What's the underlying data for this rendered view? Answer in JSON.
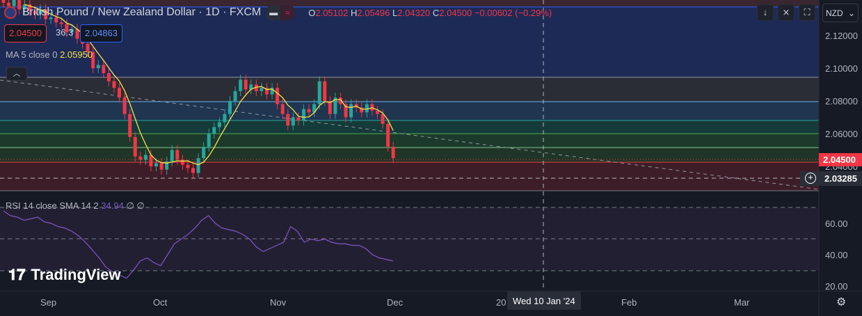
{
  "header": {
    "title": "British Pound / New Zealand Dollar · 1D · FXCM",
    "open_label": "O",
    "open": "2.05102",
    "high_label": "H",
    "high": "2.05496",
    "low_label": "L",
    "low": "2.04320",
    "close_label": "C",
    "close": "2.04500",
    "change": "−0.00602 (−0.29%)"
  },
  "price_boxes": {
    "sell": "2.04500",
    "spread": "36.3",
    "buy": "2.04863"
  },
  "ma": {
    "label": "MA 5 close 0",
    "value": "2.05950"
  },
  "rsi": {
    "label": "RSI 14 close SMA 14 2",
    "value": "34.94",
    "extra": "∅ ∅"
  },
  "toolbar": {
    "currency": "NZD"
  },
  "price_axis": {
    "ticks": [
      "2.12000",
      "2.10000",
      "2.08000",
      "2.06000",
      "2.04000"
    ],
    "last_price": "2.04500",
    "crosshair_price": "2.03285"
  },
  "rsi_axis": {
    "ticks": [
      "60.00",
      "40.00",
      "20.00"
    ]
  },
  "time_axis": {
    "ticks": [
      "Sep",
      "Oct",
      "Nov",
      "Dec",
      "20",
      "Feb",
      "Mar"
    ],
    "crosshair_date": "Wed 10 Jan '24"
  },
  "logo": "TradingView",
  "colors": {
    "up": "#26a69a",
    "down": "#f23645",
    "ma": "#f5e44a",
    "rsi": "#7e57c2"
  },
  "chart_data": {
    "type": "candlestick",
    "closes": [
      2.14,
      2.138,
      2.142,
      2.136,
      2.139,
      2.135,
      2.133,
      2.136,
      2.13,
      2.131,
      2.128,
      2.127,
      2.122,
      2.124,
      2.118,
      2.115,
      2.11,
      2.1,
      2.102,
      2.097,
      2.092,
      2.088,
      2.082,
      2.072,
      2.058,
      2.046,
      2.044,
      2.047,
      2.04,
      2.042,
      2.038,
      2.043,
      2.05,
      2.044,
      2.041,
      2.039,
      2.036,
      2.045,
      2.052,
      2.06,
      2.064,
      2.067,
      2.072,
      2.08,
      2.086,
      2.093,
      2.087,
      2.09,
      2.086,
      2.088,
      2.084,
      2.088,
      2.078,
      2.072,
      2.065,
      2.07,
      2.068,
      2.075,
      2.073,
      2.078,
      2.092,
      2.08,
      2.072,
      2.082,
      2.078,
      2.07,
      2.078,
      2.076,
      2.073,
      2.078,
      2.074,
      2.072,
      2.066,
      2.052,
      2.045
    ],
    "rsi": [
      68,
      65,
      64,
      62,
      63,
      64,
      61,
      60,
      58,
      57,
      55,
      52,
      48,
      43,
      38,
      32,
      29,
      27,
      25,
      30,
      36,
      38,
      35,
      33,
      40,
      47,
      50,
      53,
      57,
      62,
      65,
      60,
      57,
      56,
      55,
      53,
      50,
      45,
      42,
      44,
      46,
      48,
      58,
      55,
      48,
      50,
      49,
      50,
      48,
      47,
      47,
      46,
      46,
      44,
      40,
      38,
      37,
      36
    ],
    "ylim": [
      2.025,
      2.14
    ],
    "rsi_ylim": [
      15,
      80
    ]
  }
}
